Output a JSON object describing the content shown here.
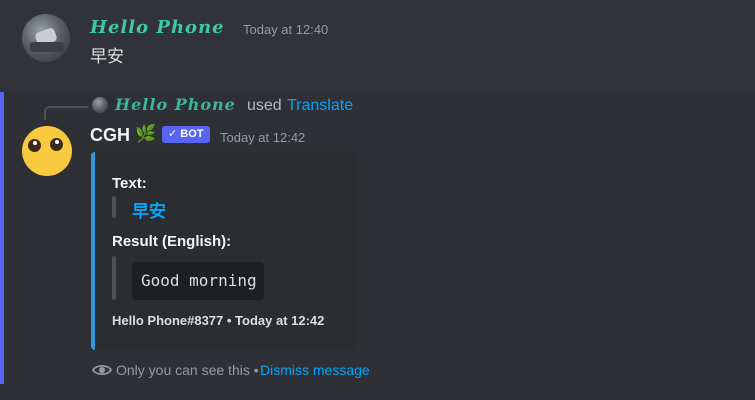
{
  "message1": {
    "author": "Hello Phone",
    "timestamp": "Today at 12:40",
    "content": "早安"
  },
  "message2": {
    "reply": {
      "author": "Hello Phone",
      "used": "used",
      "command": "Translate"
    },
    "author": "CGH",
    "author_emoji": "🌿",
    "bot_tag": "✓ BOT",
    "timestamp": "Today at 12:42",
    "embed": {
      "text_label": "Text:",
      "text_value": "早安",
      "result_label": "Result (English):",
      "result_value": "Good morning",
      "footer": "Hello Phone#8377 • Today at 12:42",
      "accent_color": "#3498db"
    },
    "ephemeral": {
      "note": "Only you can see this •",
      "dismiss": "Dismiss message"
    }
  },
  "colors": {
    "background": "#313338",
    "highlight_bar": "#5865f2",
    "link": "#00a8fc",
    "fancy_name": "#3ec9a0"
  }
}
